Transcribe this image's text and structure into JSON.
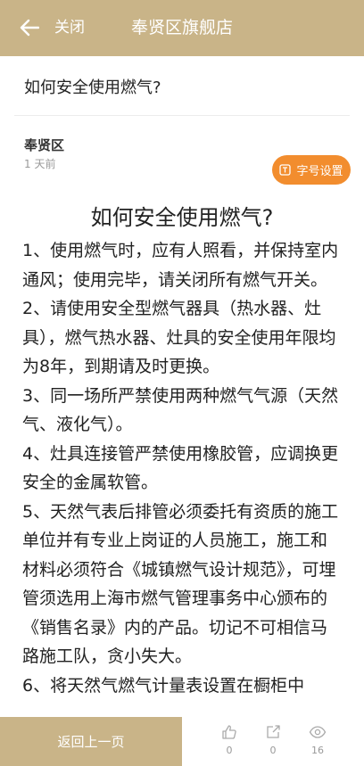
{
  "topbar": {
    "back_icon": "arrow-left-icon",
    "close_label": "关闭",
    "title": "奉贤区旗舰店"
  },
  "post": {
    "headline": "如何安全使用燃气?",
    "author": "奉贤区",
    "time": "1 天前",
    "font_button_label": "字号设置"
  },
  "article": {
    "title": "如何安全使用燃气?",
    "paragraphs": [
      "1、使用燃气时，应有人照看，并保持室内通风；使用完毕，请关闭所有燃气开关。",
      "2、请使用安全型燃气器具（热水器、灶具），燃气热水器、灶具的安全使用年限均为8年，到期请及时更换。",
      "3、同一场所严禁使用两种燃气气源（天然气、液化气）。",
      "4、灶具连接管严禁使用橡胶管，应调换更安全的金属软管。",
      "5、天然气表后排管必须委托有资质的施工单位并有专业上岗证的人员施工，施工和材料必须符合《城镇燃气设计规范》，可埋管须选用上海市燃气管理事务中心颁布的《销售名录》内的产品。切记不可相信马路施工队，贪小失大。",
      "6、将天然气燃气计量表设置在橱柜中"
    ]
  },
  "bottombar": {
    "back_label": "返回上一页",
    "likes": "0",
    "shares": "0",
    "views": "16"
  },
  "colors": {
    "brand": "#c9b488",
    "accent": "#f28d2e"
  }
}
